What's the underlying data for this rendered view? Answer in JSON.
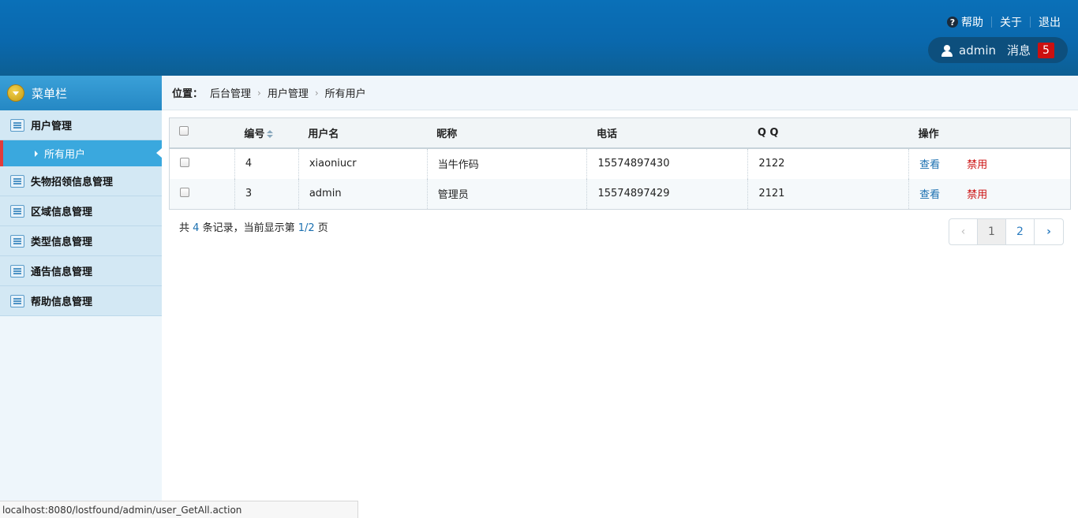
{
  "header": {
    "help": "帮助",
    "about": "关于",
    "logout": "退出",
    "username": "admin",
    "messages_label": "消息",
    "messages_count": "5"
  },
  "sidebar": {
    "title": "菜单栏",
    "items": [
      {
        "label": "用户管理",
        "icon": "list-icon"
      },
      {
        "label": "失物招领信息管理",
        "icon": "list-icon"
      },
      {
        "label": "区域信息管理",
        "icon": "list-icon"
      },
      {
        "label": "类型信息管理",
        "icon": "list-icon"
      },
      {
        "label": "通告信息管理",
        "icon": "list-icon"
      },
      {
        "label": "帮助信息管理",
        "icon": "list-icon"
      }
    ],
    "sub_item": "所有用户"
  },
  "breadcrumb": {
    "label": "位置：",
    "items": [
      "后台管理",
      "用户管理",
      "所有用户"
    ]
  },
  "table": {
    "columns": [
      "编号",
      "用户名",
      "昵称",
      "电话",
      "Q Q",
      "操作"
    ],
    "rows": [
      {
        "id": "4",
        "username": "xiaoniucr",
        "nickname": "当牛作码",
        "phone": "15574897430",
        "qq": "2122",
        "view": "查看",
        "ban": "禁用"
      },
      {
        "id": "3",
        "username": "admin",
        "nickname": "管理员",
        "phone": "15574897429",
        "qq": "2121",
        "view": "查看",
        "ban": "禁用"
      }
    ]
  },
  "summary": {
    "prefix": "共",
    "total": "4",
    "middle": "条记录，当前显示第",
    "page": "1/2",
    "suffix": "页"
  },
  "pagination": {
    "prev": "‹",
    "pages": [
      "1",
      "2"
    ],
    "next": "›"
  },
  "status_bar": "localhost:8080/lostfound/admin/user_GetAll.action",
  "colors": {
    "header": "#0a6aad",
    "accent": "#3aa8de",
    "danger": "#cc1010",
    "link": "#1a6fb0"
  }
}
